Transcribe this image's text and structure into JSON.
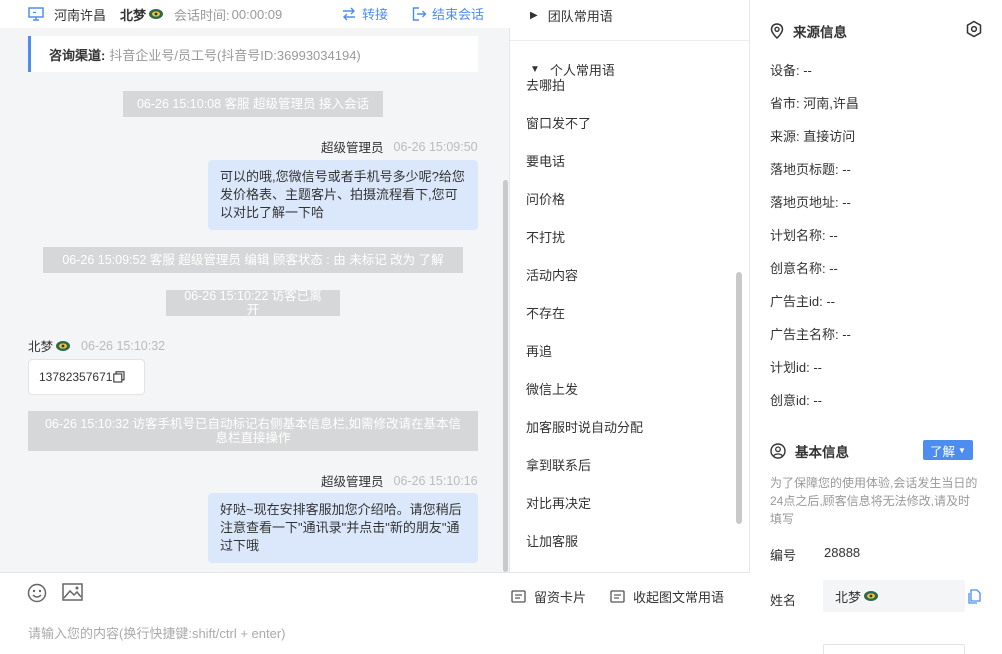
{
  "header": {
    "region": "河南许昌",
    "visitor_name": "北梦",
    "session_label": "会话时间:",
    "session_time": "00:00:09",
    "transfer_label": "转接",
    "end_label": "结束会话"
  },
  "channel": {
    "label": "咨询渠道:",
    "value": "抖音企业号/员工号(抖音号ID:36993034194)"
  },
  "messages": {
    "sys1": "06-26 15:10:08 客服 超级管理员 接入会话",
    "agent1_name": "超级管理员",
    "agent1_time": "06-26 15:09:50",
    "agent1_text": "可以的哦,您微信号或者手机号多少呢?给您发价格表、主题客片、拍摄流程看下,您可以对比了解一下哈",
    "sys2": "06-26 15:09:52 客服 超级管理员 编辑 顾客状态 : 由 未标记 改为 了解",
    "sys3": "06-26 15:10:22 访客已离开",
    "visitor1_name": "北梦",
    "visitor1_time": "06-26 15:10:32",
    "visitor1_text": "13782357671",
    "sys4": "06-26 15:10:32 访客手机号已自动标记右侧基本信息栏,如需修改请在基本信息栏直接操作",
    "agent2_name": "超级管理员",
    "agent2_time": "06-26 15:10:16",
    "agent2_text": "好哒~现在安排客服加您介绍哈。请您稍后注意查看一下\"通讯录\"并点击\"新的朋友\"通过下哦"
  },
  "input": {
    "placeholder": "请输入您的内容(换行快捷键:shift/ctrl + enter)",
    "card_label": "留资卡片",
    "collapse_label": "收起图文常用语"
  },
  "phrases": {
    "team_title": "团队常用语",
    "personal_title": "个人常用语",
    "items": [
      "去哪拍",
      "窗口发不了",
      "要电话",
      "问价格",
      "不打扰",
      "活动内容",
      "不存在",
      "再追",
      "微信上发",
      "加客服时说自动分配",
      "拿到联系后",
      "对比再决定",
      "让加客服"
    ]
  },
  "source_info": {
    "title": "来源信息",
    "rows": [
      "设备: --",
      "省市: 河南,许昌",
      "来源: 直接访问",
      "落地页标题: --",
      "落地页地址: --",
      "计划名称: --",
      "创意名称: --",
      "广告主id: --",
      "广告主名称: --",
      "计划id: --",
      "创意id: --"
    ]
  },
  "basic_info": {
    "title": "基本信息",
    "learn_label": "了解",
    "notice": "为了保障您的使用体验,会话发生当日的24点之后,顾客信息将无法修改,请及时填写",
    "id_label": "编号",
    "id_value": "28888",
    "name_label": "姓名",
    "name_value": "北梦"
  },
  "colors": {
    "accent": "#4d8df0",
    "agent_bubble": "#dbe8fb",
    "system_msg": "#d6d7d9"
  }
}
